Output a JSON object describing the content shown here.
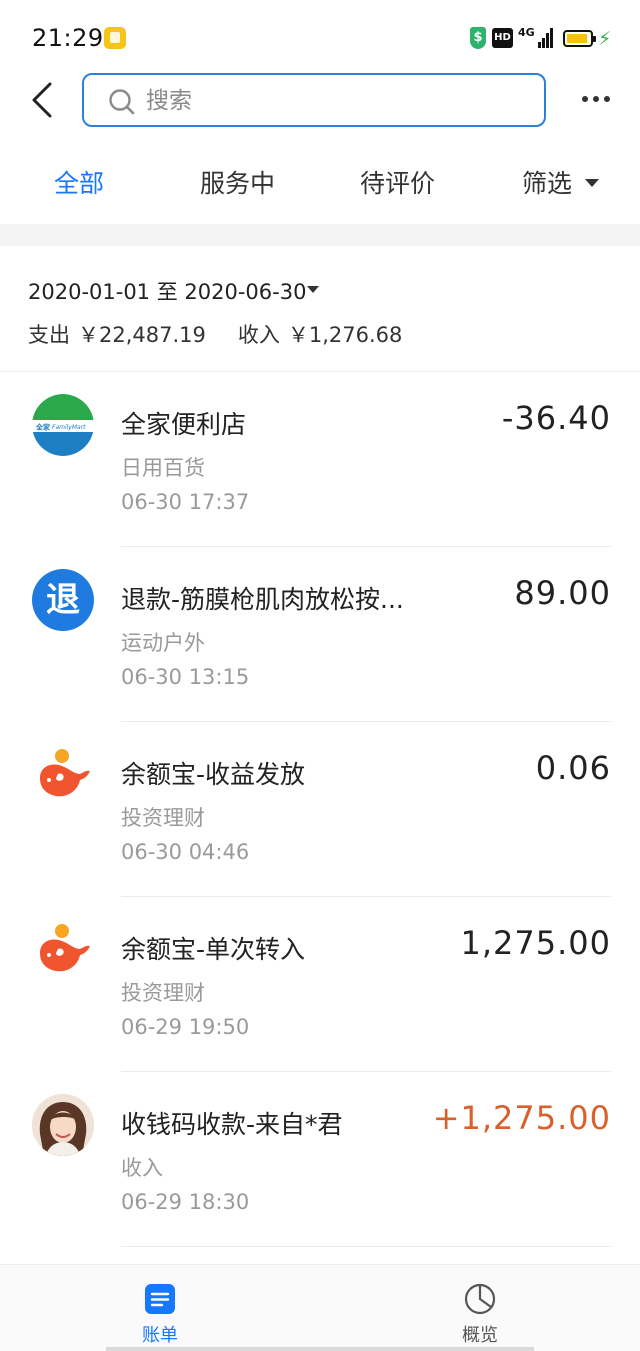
{
  "status_bar": {
    "time": "21:29",
    "shield_glyph": "$",
    "hd_label": "HD",
    "network_label": "4G",
    "colors": {
      "battery": "#f4c400",
      "charging": "#2fb24a"
    }
  },
  "header": {
    "search_placeholder": "搜索"
  },
  "tabs": [
    {
      "label": "全部",
      "active": true
    },
    {
      "label": "服务中",
      "active": false
    },
    {
      "label": "待评价",
      "active": false
    },
    {
      "label": "筛选",
      "active": false
    }
  ],
  "summary": {
    "date_range": "2020-01-01 至 2020-06-30",
    "expense_label": "支出",
    "expense_value": "￥22,487.19",
    "income_label": "收入",
    "income_value": "￥1,276.68"
  },
  "transactions": [
    {
      "icon": "familymart-logo",
      "title": "全家便利店",
      "category": "日用百货",
      "time": "06-30  17:37",
      "amount": "-36.40",
      "income": false
    },
    {
      "icon": "refund-icon",
      "icon_text": "退",
      "title": "退款-筋膜枪肌肉放松按...",
      "category": "运动户外",
      "time": "06-30  13:15",
      "amount": "89.00",
      "income": false
    },
    {
      "icon": "yuebao-icon",
      "title": "余额宝-收益发放",
      "category": "投资理财",
      "time": "06-30  04:46",
      "amount": "0.06",
      "income": false
    },
    {
      "icon": "yuebao-icon",
      "title": "余额宝-单次转入",
      "category": "投资理财",
      "time": "06-29  19:50",
      "amount": "1,275.00",
      "income": false
    },
    {
      "icon": "user-avatar",
      "title": "收钱码收款-来自*君",
      "category": "收入",
      "time": "06-29  18:30",
      "amount": "+1,275.00",
      "income": true
    }
  ],
  "bottom_nav": [
    {
      "label": "账单",
      "icon": "bill-icon",
      "active": true
    },
    {
      "label": "概览",
      "icon": "pie-chart-icon",
      "active": false
    }
  ],
  "colors": {
    "accent": "#1677ff",
    "income": "#d9602b",
    "search_border": "#2f7fd6"
  },
  "familymart_logo_text": {
    "brand_cn": "全家",
    "brand_en": "FamilyMart"
  }
}
